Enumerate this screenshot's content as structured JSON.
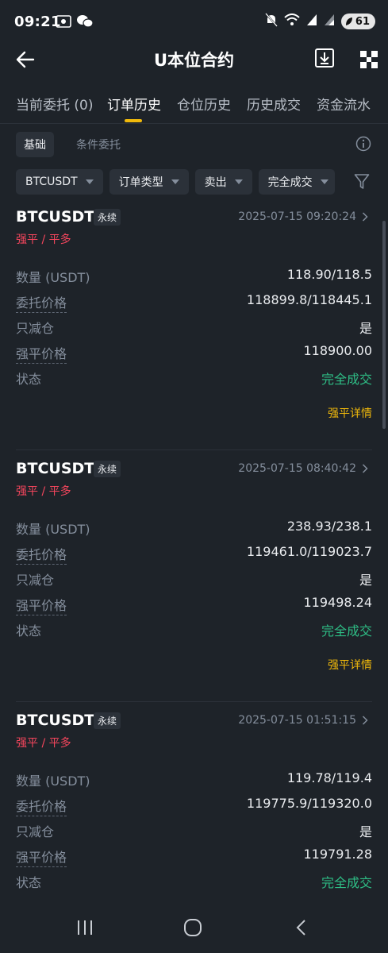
{
  "status_bar": {
    "time": "09:21",
    "battery": "61",
    "left_icons": [
      "screen-record-icon",
      "wechat-icon"
    ],
    "right_icons": [
      "mute-icon",
      "wifi-icon",
      "signal-icon",
      "signal-icon"
    ]
  },
  "header": {
    "title": "U本位合约",
    "icons": [
      "back-arrow-icon",
      "download-icon",
      "qr-scan-icon"
    ]
  },
  "tabs": [
    {
      "label": "当前委托 (0)",
      "active": false
    },
    {
      "label": "订单历史",
      "active": true
    },
    {
      "label": "仓位历史",
      "active": false
    },
    {
      "label": "历史成交",
      "active": false
    },
    {
      "label": "资金流水",
      "active": false
    }
  ],
  "subtabs": [
    {
      "label": "基础",
      "active": true
    },
    {
      "label": "条件委托",
      "active": false
    }
  ],
  "filters": [
    {
      "label": "BTCUSDT"
    },
    {
      "label": "订单类型"
    },
    {
      "label": "卖出"
    },
    {
      "label": "完全成交"
    }
  ],
  "field_labels": {
    "quantity": "数量 (USDT)",
    "order_price": "委托价格",
    "reduce_only": "只减仓",
    "liq_price": "强平价格",
    "status": "状态"
  },
  "orders": [
    {
      "symbol": "BTCUSDT",
      "tag": "永续",
      "time": "2025-07-15 09:20:24",
      "type": "强平 / 平多",
      "quantity": "118.90/118.5",
      "order_price": "118899.8/118445.1",
      "reduce_only": "是",
      "liq_price": "118900.00",
      "status": "完全成交",
      "detail_link": "强平详情"
    },
    {
      "symbol": "BTCUSDT",
      "tag": "永续",
      "time": "2025-07-15 08:40:42",
      "type": "强平 / 平多",
      "quantity": "238.93/238.1",
      "order_price": "119461.0/119023.7",
      "reduce_only": "是",
      "liq_price": "119498.24",
      "status": "完全成交",
      "detail_link": "强平详情"
    },
    {
      "symbol": "BTCUSDT",
      "tag": "永续",
      "time": "2025-07-15 01:51:15",
      "type": "强平 / 平多",
      "quantity": "119.78/119.4",
      "order_price": "119775.9/119320.0",
      "reduce_only": "是",
      "liq_price": "119791.28",
      "status": "完全成交"
    }
  ],
  "colors": {
    "background": "#1e2329",
    "accent": "#f0b90b",
    "sell_red": "#f6465d",
    "success_green": "#2ebd85",
    "muted": "#848e9c"
  }
}
